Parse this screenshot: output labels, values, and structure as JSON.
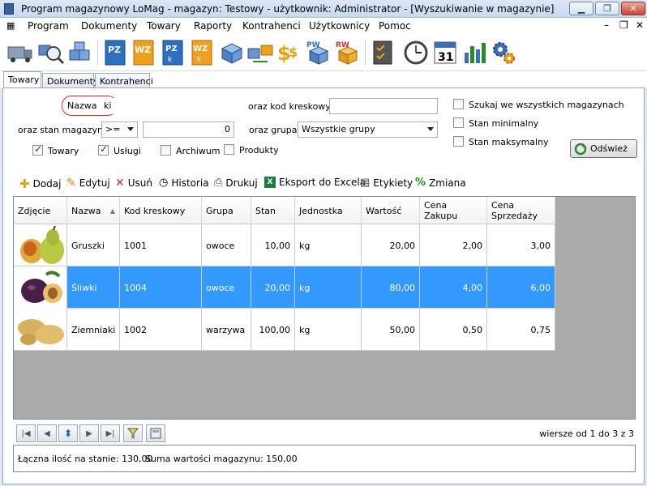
{
  "window": {
    "title": "Program magazynowy LoMag - magazyn: Testowy - użytkownik: Administrator - [Wyszukiwanie w magazynie]"
  },
  "menu": {
    "items": [
      "Program",
      "Dokumenty",
      "Towary",
      "Raporty",
      "Kontrahenci",
      "Użytkownicy",
      "Pomoc"
    ]
  },
  "toolbar": {
    "icons": [
      "truck-icon",
      "search-magnifier-icon",
      "boxes-icon",
      "pz-document-icon",
      "wz-document-icon",
      "pz-k-document-icon",
      "wz-k-document-icon",
      "box-icon",
      "transfer-icon",
      "money-icon",
      "pw-document-icon",
      "rw-document-icon",
      "checklist-icon",
      "clock-icon",
      "calendar-icon",
      "bar-chart-icon",
      "settings-gears-icon"
    ],
    "calendar_day": "31",
    "doc_labels": {
      "pz": "PZ",
      "wz": "WZ",
      "pzk": "PZ",
      "wzk": "WZ",
      "pw": "PW",
      "rw": "RW",
      "k": "k"
    }
  },
  "tabs": [
    "Towary",
    "Dokumenty",
    "Kontrahenci"
  ],
  "filters": {
    "name_label": "Nazwa",
    "name_value": "ki",
    "barcode_label": "oraz kod kreskowy",
    "barcode_value": "",
    "stock_label": "oraz stan magazynu",
    "stock_op": ">=",
    "stock_value": "0",
    "group_label": "oraz grupa",
    "group_value": "Wszystkie grupy",
    "checks": [
      {
        "label": "Towary",
        "checked": true
      },
      {
        "label": "Usługi",
        "checked": true
      },
      {
        "label": "Archiwum",
        "checked": false
      },
      {
        "label": "Produkty",
        "checked": false
      }
    ],
    "right_checks": [
      {
        "label": "Szukaj we wszystkich magazynach",
        "checked": false
      },
      {
        "label": "Stan minimalny",
        "checked": false
      },
      {
        "label": "Stan maksymalny",
        "checked": false
      }
    ],
    "refresh_label": "Odśwież"
  },
  "actions": [
    "Dodaj",
    "Edytuj",
    "Usuń",
    "Historia",
    "Drukuj",
    "Eksport do Excela",
    "Etykiety",
    "Zmiana"
  ],
  "grid": {
    "columns": [
      "Zdjęcie",
      "Nazwa",
      "Kod kreskowy",
      "Grupa",
      "Stan",
      "Jednostka",
      "Wartość",
      "Cena Zakupu",
      "Cena Sprzedaży"
    ],
    "rows": [
      {
        "image": "pear-image",
        "name": "Gruszki",
        "code": "1001",
        "group": "owoce",
        "stock": "10,00",
        "unit": "kg",
        "value": "20,00",
        "buy": "2,00",
        "sell": "3,00",
        "selected": false
      },
      {
        "image": "plum-image",
        "name": "Śliwki",
        "code": "1004",
        "group": "owoce",
        "stock": "20,00",
        "unit": "kg",
        "value": "80,00",
        "buy": "4,00",
        "sell": "6,00",
        "selected": true
      },
      {
        "image": "potato-image",
        "name": "Ziemniaki",
        "code": "1002",
        "group": "warzywa",
        "stock": "100,00",
        "unit": "kg",
        "value": "50,00",
        "buy": "0,50",
        "sell": "0,75",
        "selected": false
      }
    ]
  },
  "pager": {
    "rows_info": "wiersze od 1 do 3 z 3"
  },
  "status": {
    "total_qty": "Łączna ilość na stanie: 130,00",
    "total_value": "Suma wartości magazynu: 150,00"
  },
  "colors": {
    "selection": "#3399ff",
    "accent_red": "#d7272b",
    "header_bg": "#dbe7f6"
  }
}
